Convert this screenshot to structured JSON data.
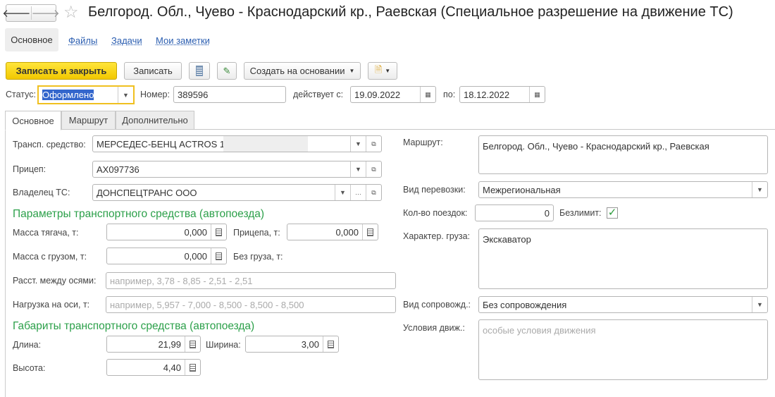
{
  "header": {
    "title": "Белгород. Обл., Чуево - Краснодарский кр., Раевская (Специальное разрешение на движение ТС)"
  },
  "nav_tabs": [
    "Основное",
    "Файлы",
    "Задачи",
    "Мои заметки"
  ],
  "toolbar": {
    "save_close": "Записать и закрыть",
    "save": "Записать",
    "create_based": "Создать на основании"
  },
  "status_row": {
    "status_label": "Статус:",
    "status_value": "Оформлено",
    "number_label": "Номер:",
    "number_value": "389596",
    "from_label": "действует с:",
    "from_value": "19.09.2022",
    "to_label": "по:",
    "to_value": "18.12.2022"
  },
  "tabs": [
    "Основное",
    "Маршрут",
    "Дополнительно"
  ],
  "left": {
    "vehicle_label": "Трансп. средство:",
    "vehicle_value": "МЕРСЕДЕС-БЕНЦ  ACTROS 1",
    "trailer_label": "Прицеп:",
    "trailer_value": "АХ097736",
    "owner_label": "Владелец ТС:",
    "owner_value": "ДОНСПЕЦТРАНС ООО",
    "params_heading": "Параметры транспортного средства (автопоезда)",
    "tractor_mass_label": "Масса тягача, т:",
    "tractor_mass_value": "0,000",
    "trailer_mass_label": "Прицепа, т:",
    "trailer_mass_value": "0,000",
    "loaded_mass_label": "Масса с грузом, т:",
    "loaded_mass_value": "0,000",
    "unloaded_label": "Без груза, т:",
    "axle_dist_label": "Расст. между осями:",
    "axle_dist_placeholder": "например, 3,78 - 8,85 - 2,51 - 2,51",
    "axle_load_label": "Нагрузка на оси, т:",
    "axle_load_placeholder": "например, 5,957 - 7,000 - 8,500 - 8,500 - 8,500",
    "dims_heading": "Габариты транспортного средства (автопоезда)",
    "length_label": "Длина:",
    "length_value": "21,99",
    "width_label": "Ширина:",
    "width_value": "3,00",
    "height_label": "Высота:",
    "height_value": "4,40"
  },
  "right": {
    "route_label": "Маршрут:",
    "route_value": "Белгород. Обл., Чуево - Краснодарский кр., Раевская",
    "transport_type_label": "Вид перевозки:",
    "transport_type_value": "Межрегиональная",
    "trips_label": "Кол-во поездок:",
    "trips_value": "0",
    "unlimited_label": "Безлимит:",
    "unlimited_checked": true,
    "cargo_label": "Характер. груза:",
    "cargo_value": "Экскаватор",
    "escort_label": "Вид сопровожд.:",
    "escort_value": "Без сопровождения",
    "conditions_label": "Условия движ.:",
    "conditions_placeholder": "особые условия движения"
  }
}
